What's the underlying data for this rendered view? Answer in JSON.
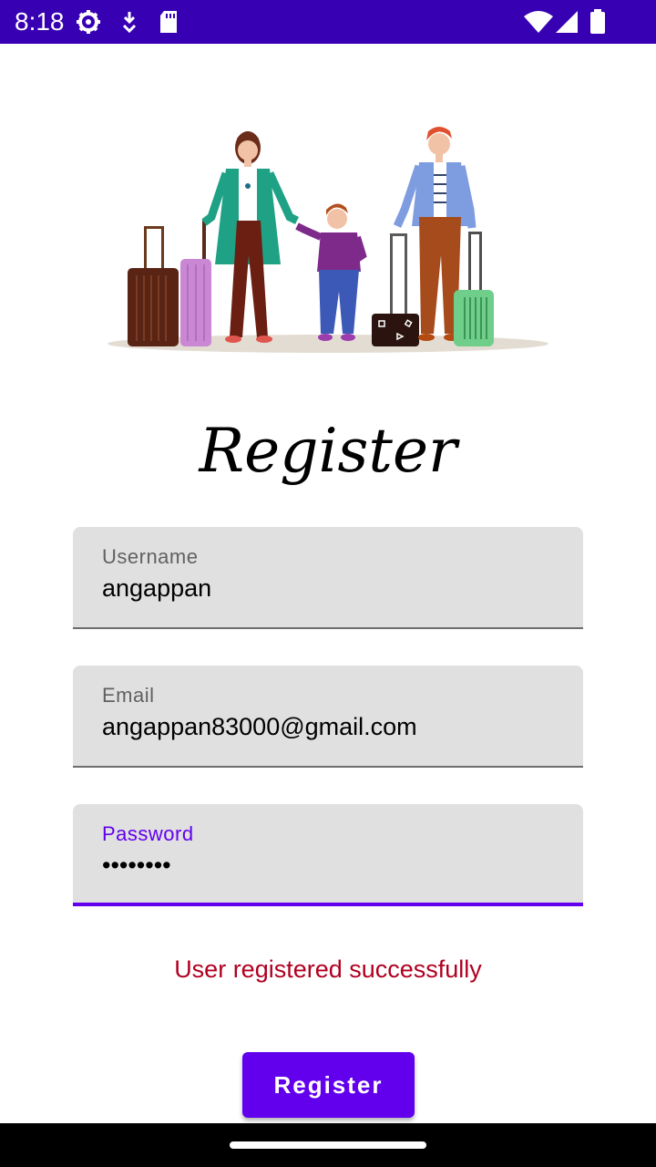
{
  "status_bar": {
    "time": "8:18",
    "icons": [
      "gear-icon",
      "download-icon",
      "sd-card-icon",
      "wifi-icon",
      "signal-icon",
      "battery-icon"
    ],
    "background": "#3700b3"
  },
  "illustration": {
    "icon": "family-travel-illustration"
  },
  "title": "Register",
  "form": {
    "username": {
      "label": "Username",
      "value": "angappan"
    },
    "email": {
      "label": "Email",
      "value": "angappan83000@gmail.com"
    },
    "password": {
      "label": "Password",
      "value": "••••••••"
    }
  },
  "status_message": "User registered successfully",
  "register_button": "Register",
  "colors": {
    "primary": "#6200ee",
    "status_bar": "#3700b3",
    "error_text": "#b00020",
    "field_bg": "#e0e0e0"
  }
}
